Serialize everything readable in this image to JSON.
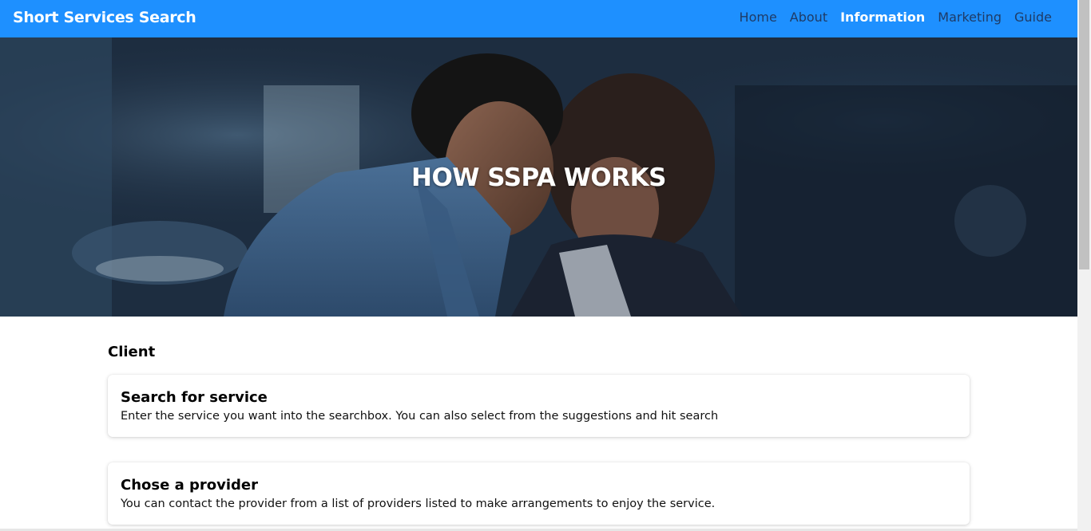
{
  "navbar": {
    "brand": "Short Services Search",
    "links": [
      {
        "label": "Home",
        "active": false
      },
      {
        "label": "About",
        "active": false
      },
      {
        "label": "Information",
        "active": true
      },
      {
        "label": "Marketing",
        "active": false
      },
      {
        "label": "Guide",
        "active": false
      }
    ]
  },
  "hero": {
    "title": "HOW SSPA WORKS",
    "image": "hero-photo-two-people-working"
  },
  "client_section": {
    "title": "Client",
    "cards": [
      {
        "title": "Search for service",
        "text": "Enter the service you want into the searchbox. You can also select from the suggestions and hit search"
      },
      {
        "title": "Chose a provider",
        "text": "You can contact the provider from a list of providers listed to make arrangements to enjoy the service."
      }
    ]
  },
  "colors": {
    "navbar_bg": "#1e90ff",
    "nav_link": "#1f3b66",
    "nav_active": "#ffffff"
  }
}
